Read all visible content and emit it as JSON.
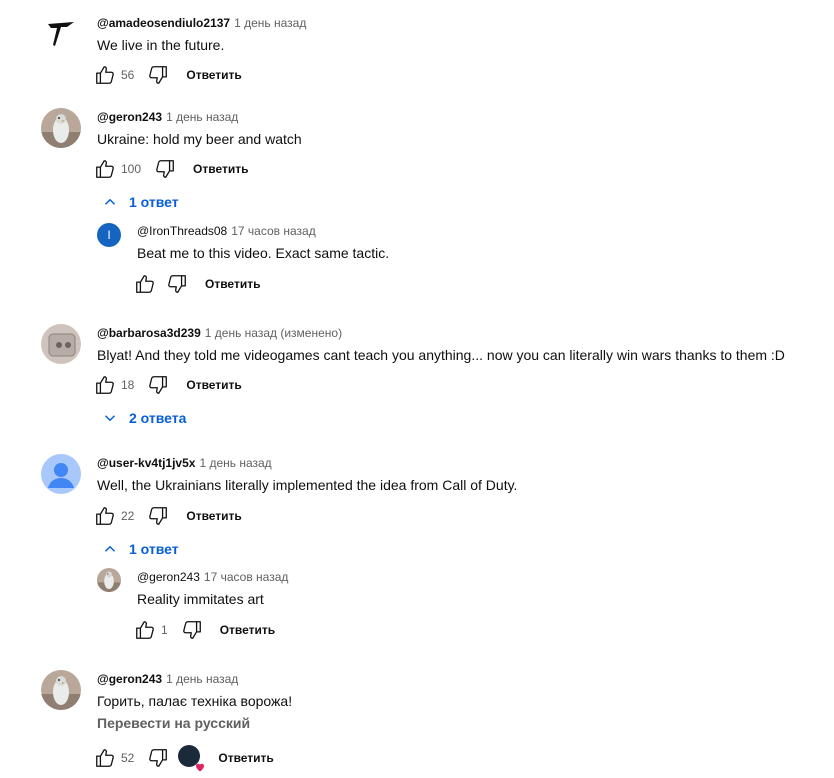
{
  "ui": {
    "reply_label": "Ответить",
    "translate_label": "Перевести на русский"
  },
  "comments": [
    {
      "author": "@amadeosendiulo2137",
      "time": "1 день назад",
      "text": "We live in the future.",
      "likes": "56"
    },
    {
      "author": "@geron243",
      "time": "1 день назад",
      "text": "Ukraine: hold my beer and watch",
      "likes": "100",
      "replies_toggle": "1 ответ",
      "replies": [
        {
          "author": "@IronThreads08",
          "time": "17 часов назад",
          "text": "Beat me to this video. Exact same tactic.",
          "likes": "",
          "avatar_letter": "I"
        }
      ]
    },
    {
      "author": "@barbarosa3d239",
      "time": "1 день назад (изменено)",
      "text": "Blyat! And they told me videogames cant teach you anything... now you can literally win wars thanks to them :D",
      "likes": "18",
      "replies_toggle": "2 ответа"
    },
    {
      "author": "@user-kv4tj1jv5x",
      "time": "1 день назад",
      "text": "Well, the Ukrainians literally implemented the idea from Call of Duty.",
      "likes": "22",
      "replies_toggle": "1 ответ",
      "replies": [
        {
          "author": "@geron243",
          "time": "17 часов назад",
          "text": "Reality immitates art",
          "likes": "1"
        }
      ]
    },
    {
      "author": "@geron243",
      "time": "1 день назад",
      "text": "Горить, палає техніка ворожа!",
      "likes": "52"
    }
  ],
  "colors": {
    "link": "#065fd4",
    "muted": "#606060",
    "text": "#0f0f0f",
    "heart": "#e0245e"
  }
}
